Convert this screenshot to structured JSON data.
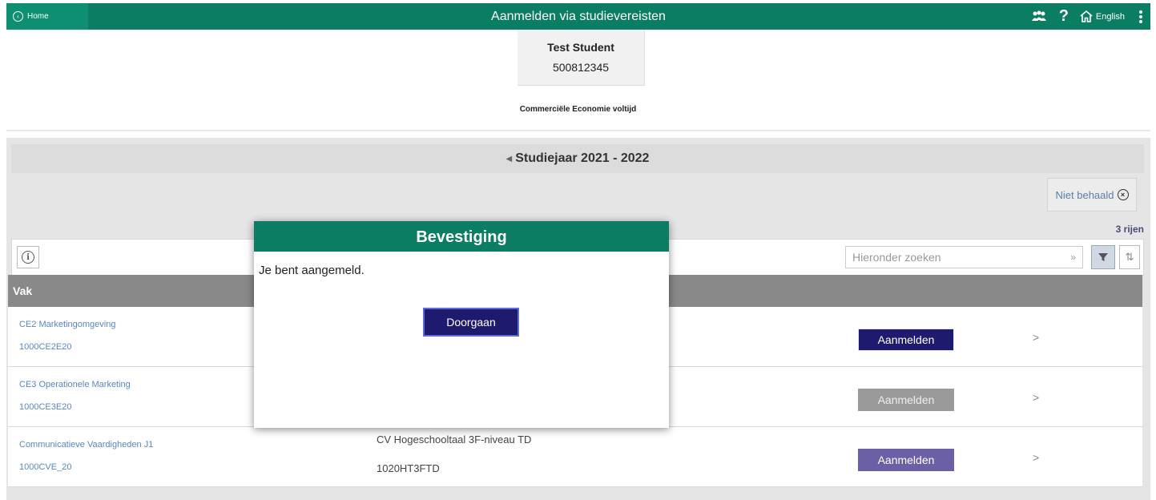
{
  "topbar": {
    "home_label": "Home",
    "title": "Aanmelden via studievereisten",
    "lang_label": "English",
    "icons": [
      "people-icon",
      "help-icon",
      "house-icon",
      "kebab-menu-icon"
    ],
    "accent": "#0b7d63"
  },
  "student": {
    "name": "Test Student",
    "number": "500812345",
    "program": "Commerciële Economie voltijd"
  },
  "year": {
    "label": "Studiejaar 2021 - 2022"
  },
  "filter_chip": {
    "label": "Niet behaald"
  },
  "rows_count": "3 rijen",
  "search": {
    "placeholder": "Hieronder zoeken"
  },
  "table": {
    "column_vak": "Vak",
    "rows": [
      {
        "name": "CE2 Marketingomgeving",
        "code": "1000CE2E20",
        "req_name": "",
        "req_code": "",
        "button": "Aanmelden",
        "state": "active"
      },
      {
        "name": "CE3 Operationele Marketing",
        "code": "1000CE3E20",
        "req_name": "",
        "req_code": "",
        "button": "Aanmelden",
        "state": "disabled"
      },
      {
        "name": "Communicatieve Vaardigheden J1",
        "code": "1000CVE_20",
        "req_name": "CV Hogeschooltaal 3F-niveau TD",
        "req_code": "1020HT3FTD",
        "button": "Aanmelden",
        "state": "muted"
      }
    ]
  },
  "dialog": {
    "title": "Bevestiging",
    "message": "Je bent aangemeld.",
    "button": "Doorgaan"
  },
  "colors": {
    "button_active": "#1e1b6e",
    "button_disabled": "#9a9a9a",
    "button_muted": "#6b5fa6",
    "link": "#5a86c4"
  }
}
